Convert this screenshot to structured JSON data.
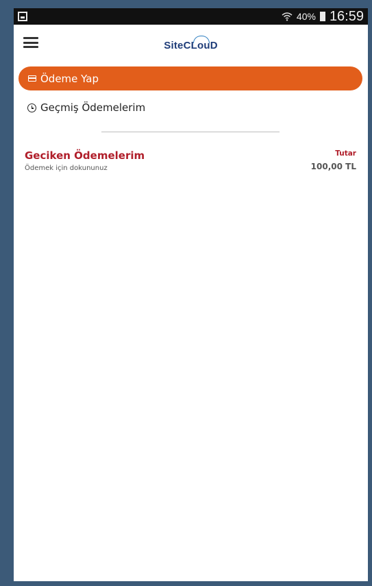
{
  "statusbar": {
    "battery": "40%",
    "time": "16:59"
  },
  "appbar": {
    "logo": "SiteCLouD"
  },
  "actions": {
    "pay_label": "Ödeme Yap",
    "history_label": "Geçmiş Ödemelerim"
  },
  "overdue": {
    "title": "Geciken Ödemelerim",
    "subtitle": "Ödemek için dokununuz",
    "amount_label": "Tutar",
    "amount_value": "100,00 TL"
  },
  "colors": {
    "accent": "#e25e1b",
    "alert": "#b01e2a",
    "frame": "#3c5a78"
  }
}
